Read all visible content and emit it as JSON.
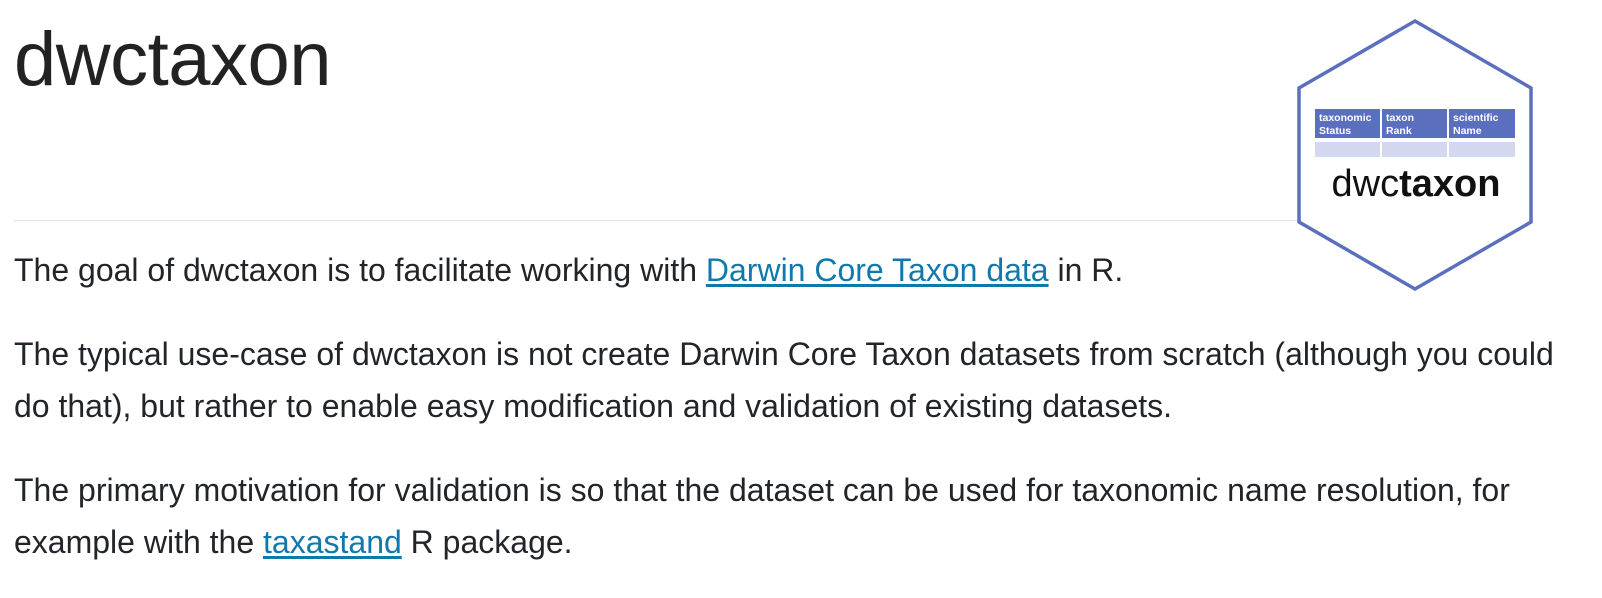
{
  "page": {
    "title": "dwctaxon"
  },
  "logo": {
    "headers": [
      {
        "line1": "taxonomic",
        "line2": "Status"
      },
      {
        "line1": "taxon",
        "line2": "Rank"
      },
      {
        "line1": "scientific",
        "line2": "Name"
      }
    ],
    "name_light": "dwc",
    "name_bold": "taxon",
    "colors": {
      "border": "#5b6fbf",
      "header_fill": "#5b6fbf",
      "row_fill": "#d4d8ee",
      "text": "#111111"
    }
  },
  "content": {
    "p1": {
      "before": "The goal of dwctaxon is to facilitate working with ",
      "link": "Darwin Core Taxon data",
      "after": " in R."
    },
    "p2": "The typical use-case of dwctaxon is not create Darwin Core Taxon datasets from scratch (although you could do that), but rather to enable easy modification and validation of existing datasets.",
    "p3": {
      "before": "The primary motivation for validation is so that the dataset can be used for taxonomic name resolution, for example with the ",
      "link": "taxastand",
      "after": " R package."
    }
  },
  "colors": {
    "link": "#0f79ad",
    "text": "#212529",
    "divider": "#dee2e6"
  }
}
